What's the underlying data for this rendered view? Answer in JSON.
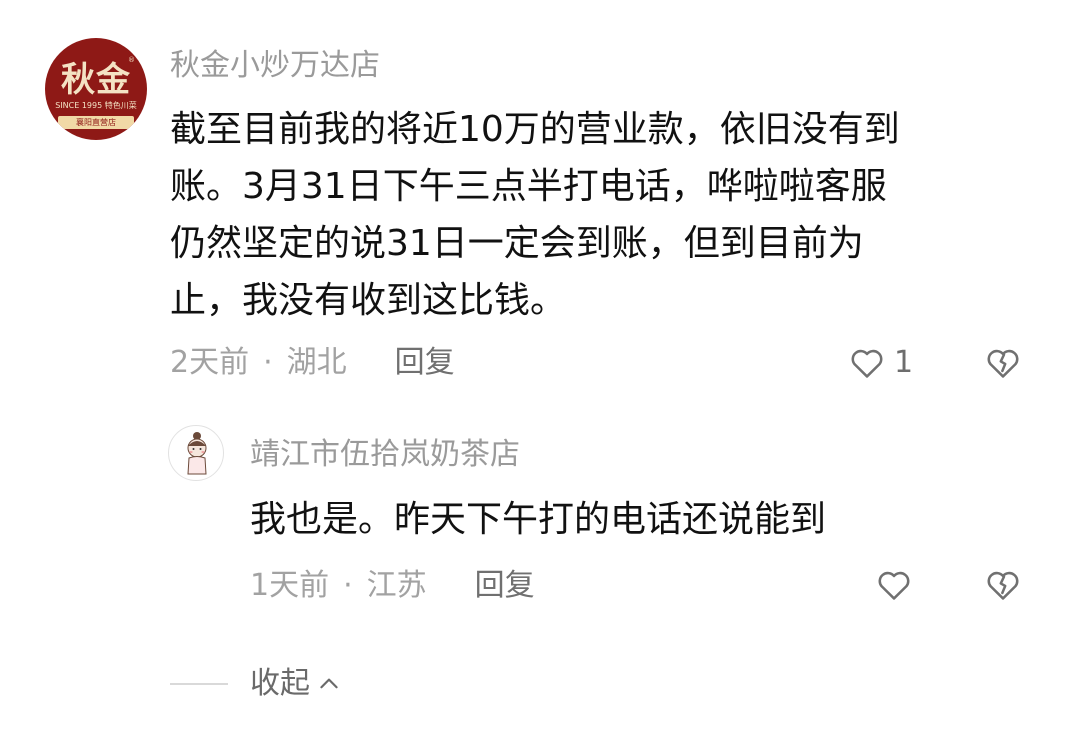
{
  "comment": {
    "author": "秋金小炒万达店",
    "avatar": {
      "logo": "秋金",
      "since": "SINCE 1995 特色川菜",
      "banner": "襄阳直营店",
      "reg": "®"
    },
    "lines": [
      "截至目前我的将近10万的营业款，依旧没有到",
      "账。3月31日下午三点半打电话，哗啦啦客服",
      "仍然坚定的说31日一定会到账，但到目前为",
      "止，我没有收到这比钱。"
    ],
    "time": "2天前",
    "separator": "·",
    "location": "湖北",
    "reply_label": "回复",
    "like_count": "1"
  },
  "reply": {
    "author": "靖江市伍拾岚奶茶店",
    "text": "我也是。昨天下午打的电话还说能到",
    "time": "1天前",
    "separator": "·",
    "location": "江苏",
    "reply_label": "回复"
  },
  "collapse_label": "收起",
  "icons": [
    "heart-icon",
    "heart-broken-icon",
    "chevron-up-icon"
  ]
}
